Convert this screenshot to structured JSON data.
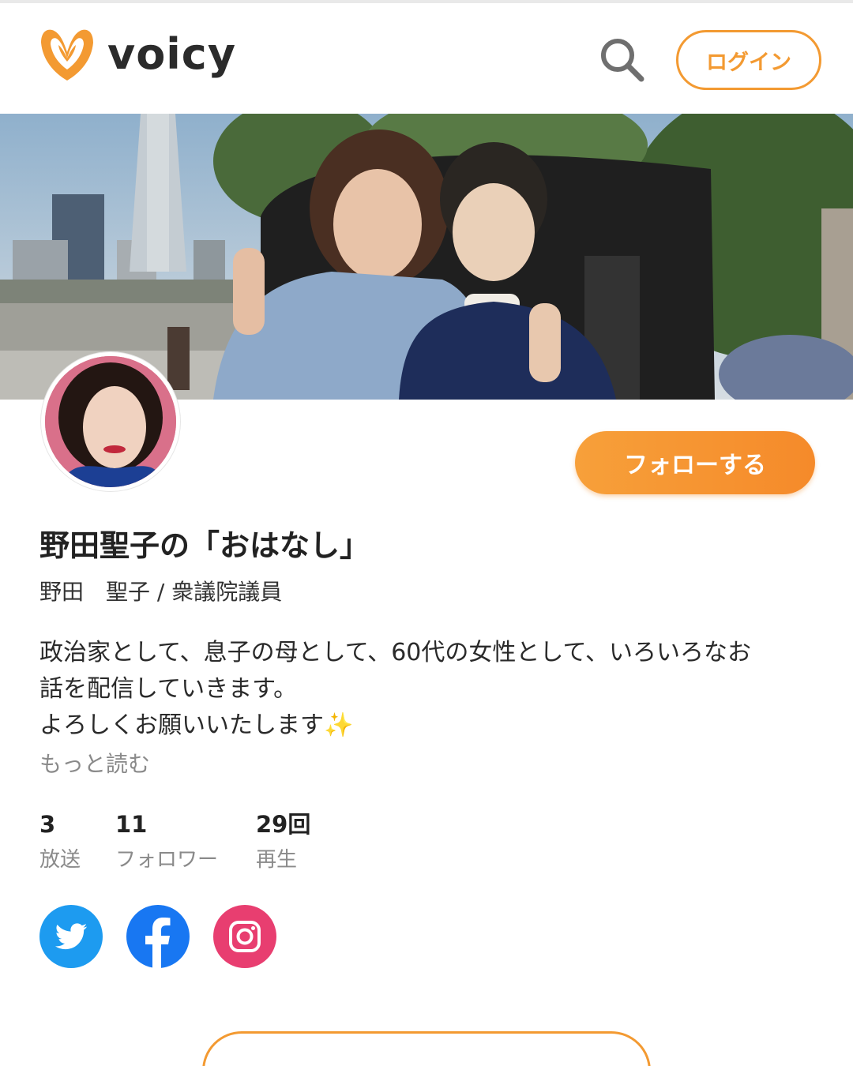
{
  "header": {
    "logo_text": "voicy",
    "search_icon": "search-icon",
    "login_label": "ログイン",
    "accent_color": "#f39a32"
  },
  "channel": {
    "follow_label": "フォローする",
    "title": "野田聖子の「おはなし」",
    "subtitle": "野田　聖子 / 衆議院議員",
    "description_lines": [
      "政治家として、息子の母として、60代の女性として、いろいろなお",
      "話を配信していきます。",
      "よろしくお願いいたします✨"
    ],
    "read_more": "もっと読む"
  },
  "stats": [
    {
      "value": "3",
      "label": "放送"
    },
    {
      "value": "11",
      "label": "フォロワー"
    },
    {
      "value": "29回",
      "label": "再生"
    }
  ],
  "social": [
    {
      "name": "twitter-icon",
      "color": "#1d9bf0"
    },
    {
      "name": "facebook-icon",
      "color": "#1877f2"
    },
    {
      "name": "instagram-icon",
      "color": "#e83e70"
    }
  ]
}
